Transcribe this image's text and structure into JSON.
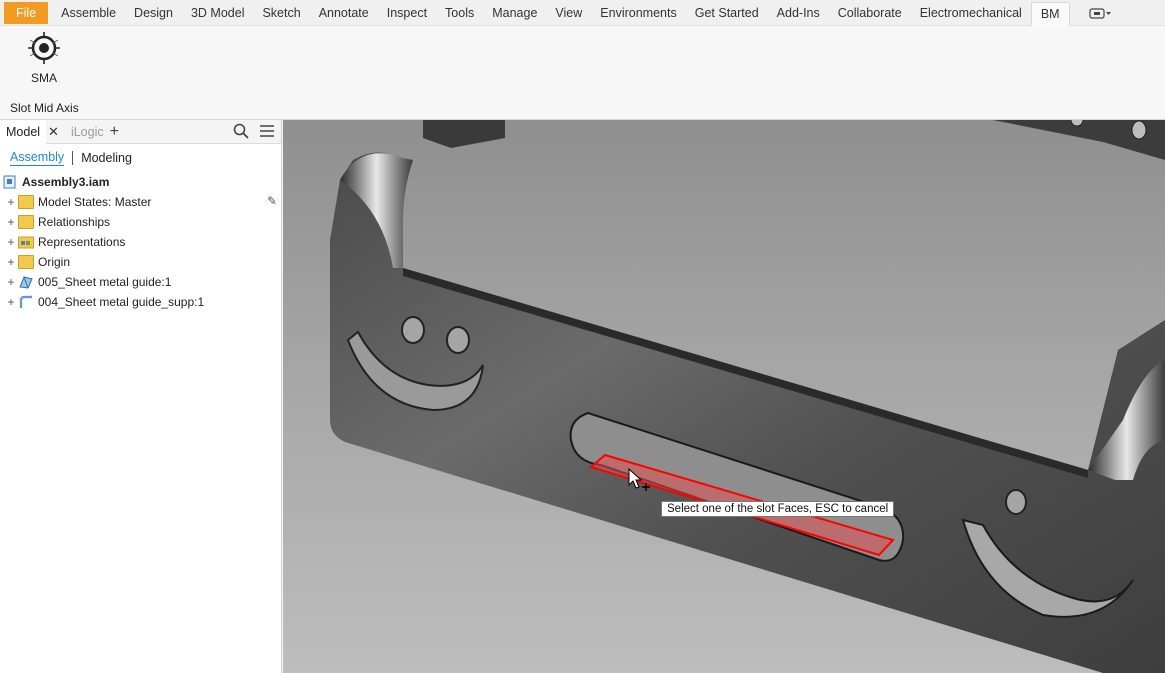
{
  "ribbon_tabs": [
    "File",
    "Assemble",
    "Design",
    "3D Model",
    "Sketch",
    "Annotate",
    "Inspect",
    "Tools",
    "Manage",
    "View",
    "Environments",
    "Get Started",
    "Add-Ins",
    "Collaborate",
    "Electromechanical",
    "BM"
  ],
  "active_tab": "BM",
  "ribbon": {
    "button_label": "SMA",
    "panel_title": "Slot Mid Axis"
  },
  "browser": {
    "tabs": [
      "Model",
      "iLogic"
    ],
    "subtabs": [
      "Assembly",
      "Modeling"
    ],
    "root": "Assembly3.iam",
    "items": [
      {
        "label": "Model States: Master",
        "icon": "folder-icon"
      },
      {
        "label": "Relationships",
        "icon": "folder-icon"
      },
      {
        "label": "Representations",
        "icon": "representations-folder-icon"
      },
      {
        "label": "Origin",
        "icon": "folder-icon"
      },
      {
        "label": "005_Sheet metal guide:1",
        "icon": "sheet-metal-part-icon"
      },
      {
        "label": "004_Sheet metal guide_supp:1",
        "icon": "sheet-metal-part-icon"
      }
    ]
  },
  "viewport": {
    "tooltip": "Select one of the slot Faces, ESC to cancel"
  },
  "colors": {
    "file_tab": "#f29b22",
    "accent_blue": "#1e88d6",
    "highlight": "#ff0000"
  }
}
